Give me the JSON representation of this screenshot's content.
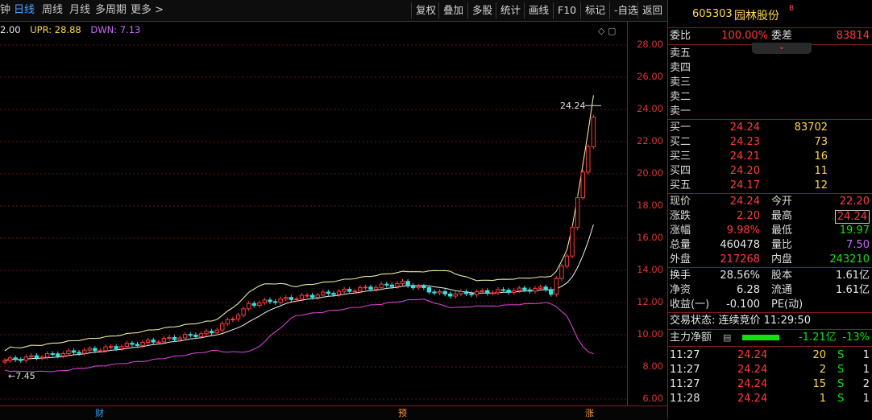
{
  "toolbar": {
    "period_tabs": [
      "钟",
      "日线",
      "周线",
      "月线",
      "多周期",
      "更多 >"
    ],
    "buttons": [
      "复权",
      "叠加",
      "多股",
      "统计",
      "画线",
      "F10",
      "标记",
      "-自选",
      "返回"
    ]
  },
  "indicator": {
    "mid": "2.00",
    "upr_label": "UPR: 28.88",
    "dwn_label": "DWN: 7.13"
  },
  "chart_data": {
    "type": "candlestick",
    "ylim": [
      5.5,
      29.5
    ],
    "y_ticks": [
      "28.00",
      "26.00",
      "24.00",
      "22.00",
      "20.00",
      "18.00",
      "16.00",
      "14.00",
      "12.00",
      "10.00",
      "8.00",
      "6.00"
    ],
    "annotations": {
      "high_label": "24.24",
      "low_label": "7.45"
    },
    "events": [
      "财",
      "预",
      "涨"
    ]
  },
  "stock": {
    "code": "605303",
    "name": "园林股份",
    "badge": "B"
  },
  "order": {
    "weibi_label": "委比",
    "weibi": "100.00%",
    "weicha_label": "委差",
    "weicha": "83814",
    "asks": [
      {
        "label": "卖五"
      },
      {
        "label": "卖四"
      },
      {
        "label": "卖三"
      },
      {
        "label": "卖二"
      },
      {
        "label": "卖一"
      }
    ],
    "bids": [
      {
        "label": "买一",
        "price": "24.24",
        "vol": "83702"
      },
      {
        "label": "买二",
        "price": "24.23",
        "vol": "73"
      },
      {
        "label": "买三",
        "price": "24.21",
        "vol": "16"
      },
      {
        "label": "买四",
        "price": "24.20",
        "vol": "11"
      },
      {
        "label": "买五",
        "price": "24.17",
        "vol": "12"
      }
    ]
  },
  "quote": [
    {
      "l1": "现价",
      "v1": "24.24",
      "l2": "今开",
      "v2": "22.20"
    },
    {
      "l1": "涨跌",
      "v1": "2.20",
      "l2": "最高",
      "v2": "24.24"
    },
    {
      "l1": "涨幅",
      "v1": "9.98%",
      "l2": "最低",
      "v2": "19.97"
    },
    {
      "l1": "总量",
      "v1": "460478",
      "l2": "量比",
      "v2": "7.50"
    },
    {
      "l1": "外盘",
      "v1": "217268",
      "l2": "内盘",
      "v2": "243210"
    }
  ],
  "fund": [
    {
      "l1": "换手",
      "v1": "28.56%",
      "l2": "股本",
      "v2": "1.61亿"
    },
    {
      "l1": "净资",
      "v1": "6.28",
      "l2": "流通",
      "v2": "1.61亿"
    },
    {
      "l1": "收益(一)",
      "v1": "-0.100",
      "l2": "PE(动)",
      "v2": ""
    }
  ],
  "status": {
    "text": "交易状态: 连续竞价 11:29:50"
  },
  "mainflow": {
    "label": "主力净额",
    "value": "-1.21亿",
    "pct": "-13%"
  },
  "ticks": [
    {
      "time": "11:27",
      "price": "24.24",
      "vol": "20",
      "side": "S",
      "n": "1"
    },
    {
      "time": "11:27",
      "price": "24.24",
      "vol": "2",
      "side": "S",
      "n": "1"
    },
    {
      "time": "11:27",
      "price": "24.24",
      "vol": "15",
      "side": "S",
      "n": "2"
    },
    {
      "time": "11:28",
      "price": "24.24",
      "vol": "1",
      "side": "S",
      "n": "1"
    }
  ]
}
